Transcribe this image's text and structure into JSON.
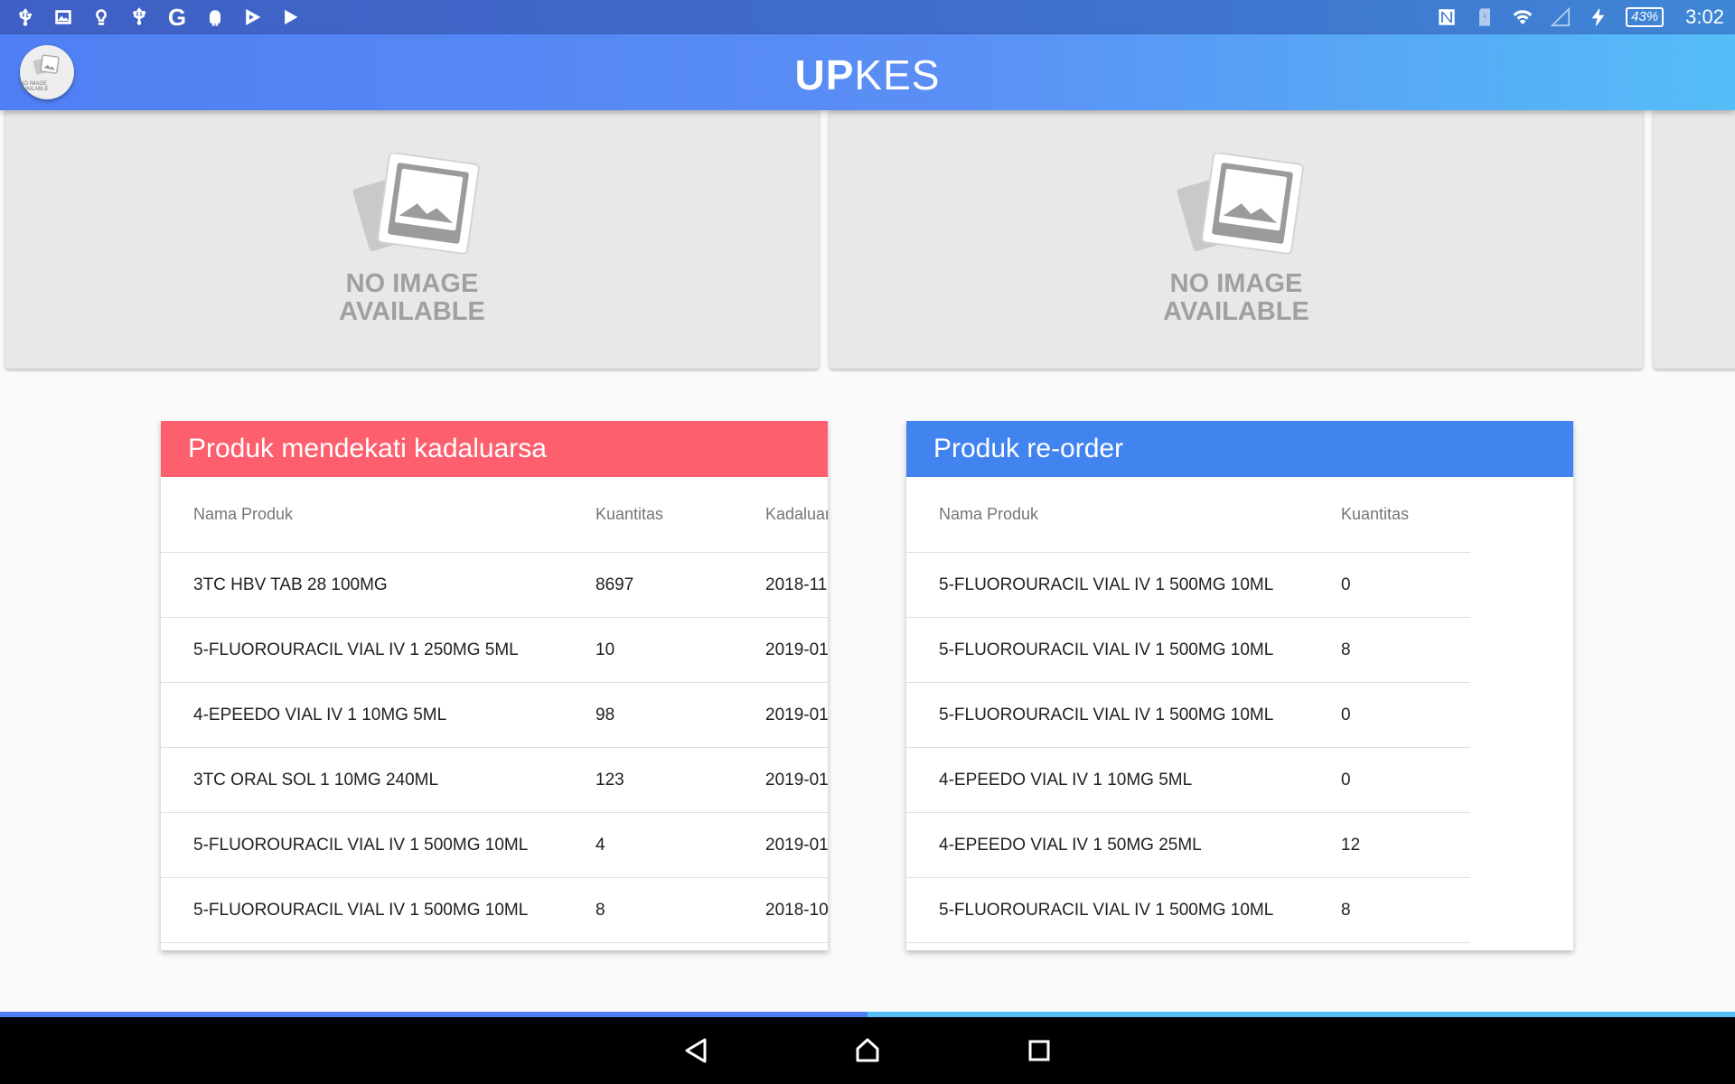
{
  "status_bar": {
    "left_icons": [
      "usb-icon",
      "image-icon",
      "bulb-icon",
      "usb-debug-icon",
      "google-icon",
      "android-icon",
      "play-store-icon",
      "play-icon"
    ],
    "right_icons": [
      "nfc-icon",
      "sim-alert-icon",
      "wifi-icon",
      "signal-icon",
      "charging-icon"
    ],
    "battery": "43%",
    "time": "3:02"
  },
  "app_bar": {
    "title_bold": "UP",
    "title_light": "KES",
    "avatar_text": "NO IMAGE AVAILABLE"
  },
  "carousel": {
    "slides": [
      {
        "text_line1": "NO IMAGE",
        "text_line2": "AVAILABLE"
      },
      {
        "text_line1": "NO IMAGE",
        "text_line2": "AVAILABLE"
      }
    ]
  },
  "expiring_card": {
    "title": "Produk mendekati kadaluarsa",
    "columns": [
      "Nama Produk",
      "Kuantitas",
      "Kadaluarsa"
    ],
    "rows": [
      [
        "3TC HBV TAB 28 100MG",
        "8697",
        "2018-11"
      ],
      [
        "5-FLUOROURACIL VIAL IV 1 250MG 5ML",
        "10",
        "2019-01"
      ],
      [
        "4-EPEEDO VIAL IV 1 10MG 5ML",
        "98",
        "2019-01"
      ],
      [
        "3TC ORAL SOL 1 10MG 240ML",
        "123",
        "2019-01"
      ],
      [
        "5-FLUOROURACIL VIAL IV 1 500MG 10ML",
        "4",
        "2019-01"
      ],
      [
        "5-FLUOROURACIL VIAL IV 1 500MG 10ML",
        "8",
        "2018-10"
      ]
    ],
    "header_color": "#fe5f6e"
  },
  "reorder_card": {
    "title": "Produk re-order",
    "columns": [
      "Nama Produk",
      "Kuantitas"
    ],
    "rows": [
      [
        "5-FLUOROURACIL VIAL IV 1 500MG 10ML",
        "0"
      ],
      [
        "5-FLUOROURACIL VIAL IV 1 500MG 10ML",
        "8"
      ],
      [
        "5-FLUOROURACIL VIAL IV 1 500MG 10ML",
        "0"
      ],
      [
        "4-EPEEDO VIAL IV 1 10MG 5ML",
        "0"
      ],
      [
        "4-EPEEDO VIAL IV 1 50MG 25ML",
        "12"
      ],
      [
        "5-FLUOROURACIL VIAL IV 1 500MG 10ML",
        "8"
      ]
    ],
    "header_color": "#4284ef"
  },
  "nav_bar": {
    "buttons": [
      "back-icon",
      "home-icon",
      "recents-icon"
    ]
  }
}
